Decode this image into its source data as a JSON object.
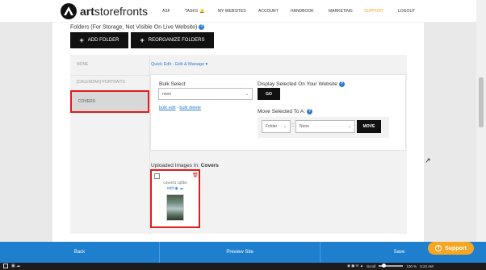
{
  "nav": {
    "brand_strong": "art",
    "brand_rest": "storefronts",
    "links": {
      "asf": "ASF",
      "tasks": "TASKS",
      "my_websites": "MY WEBSITES",
      "account": "ACCOUNT",
      "handbook": "HANDBOOK",
      "marketing": "MARKETING",
      "support": "SUPPORT",
      "logout": "LOGOUT"
    }
  },
  "folders_header": {
    "title": "Folders (For Storage, Not Visible On Live Website)",
    "help": "?"
  },
  "buttons": {
    "add_folder": "ADD FOLDER",
    "reorganize_folders": "REORGANIZE FOLDERS",
    "go": "GO",
    "move": "MOVE"
  },
  "folders": [
    "NONE",
    "[CALENDAR] PORTRAITS",
    "COVERS"
  ],
  "quick_edit": "Quick Edit - Edit & Manage ▾",
  "bulk": {
    "label": "Bulk Select",
    "value": "none",
    "link_edit": "bulk edit",
    "link_sep": " - ",
    "link_delete": "bulk delete"
  },
  "display": {
    "label": "Display Selected On Your Website",
    "help": "?"
  },
  "move": {
    "label": "Move Selected To A:",
    "help": "?",
    "type_value": "Folder",
    "colon": ":",
    "target_value": "None"
  },
  "uploaded": {
    "label_prefix": "Uploaded Images In: ",
    "label_folder": "Covers"
  },
  "thumb": {
    "name": "cover01 cgftbs",
    "action": "edit"
  },
  "bottom": {
    "back": "Back",
    "preview": "Preview Site",
    "save": "Save"
  },
  "support_button": "Support",
  "taskbar": {
    "scroll": "Scroll",
    "zoom": "100 %",
    "time": "5:24 AM"
  },
  "colors": {
    "accent_blue": "#1f7fcf",
    "support_orange": "#f5a623",
    "highlight_red": "#e31b1b"
  }
}
